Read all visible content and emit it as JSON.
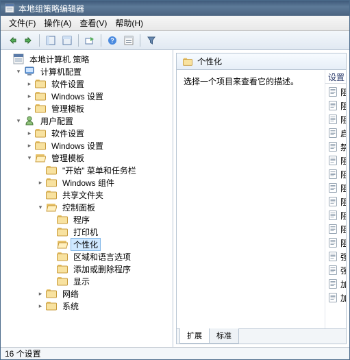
{
  "window": {
    "title": "本地组策略编辑器"
  },
  "menu": {
    "file": "文件(F)",
    "action": "操作(A)",
    "view": "查看(V)",
    "help": "帮助(H)"
  },
  "tree": {
    "root": "本地计算机 策略",
    "computer": {
      "label": "计算机配置",
      "software": "软件设置",
      "windows": "Windows 设置",
      "templates": "管理模板"
    },
    "user": {
      "label": "用户配置",
      "software": "软件设置",
      "windows": "Windows 设置",
      "templates": {
        "label": "管理模板",
        "startmenu": "\"开始\" 菜单和任务栏",
        "wincomp": "Windows 组件",
        "shared": "共享文件夹",
        "cp": {
          "label": "控制面板",
          "programs": "程序",
          "printers": "打印机",
          "personalization": "个性化",
          "regional": "区域和语言选项",
          "addremove": "添加或删除程序",
          "display": "显示"
        },
        "network": "网络",
        "system": "系统"
      }
    }
  },
  "right": {
    "header_title": "个性化",
    "desc": "选择一个项目来查看它的描述。",
    "settings_header": "设置",
    "policies": [
      {
        "label": "阻"
      },
      {
        "label": "阻"
      },
      {
        "label": "阻"
      },
      {
        "label": "启"
      },
      {
        "label": "禁"
      },
      {
        "label": "阻"
      },
      {
        "label": "阻"
      },
      {
        "label": "阻"
      },
      {
        "label": "阻"
      },
      {
        "label": "阻"
      },
      {
        "label": "阻"
      },
      {
        "label": "阻"
      },
      {
        "label": "强"
      },
      {
        "label": "强"
      },
      {
        "label": "加"
      },
      {
        "label": "加"
      }
    ],
    "tabs": {
      "extended": "扩展",
      "standard": "标准"
    }
  },
  "status": {
    "text": "16 个设置"
  }
}
